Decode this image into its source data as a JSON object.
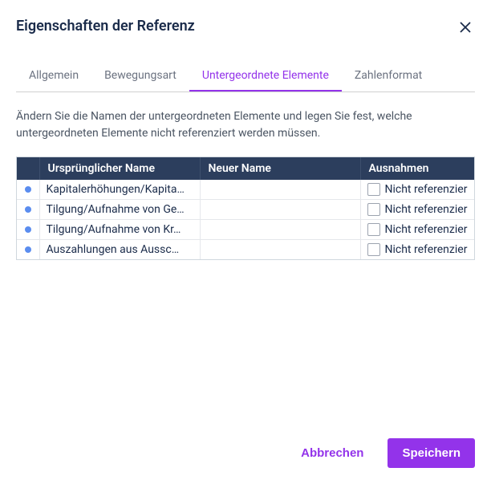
{
  "dialog": {
    "title": "Eigenschaften der Referenz"
  },
  "tabs": [
    {
      "label": "Allgemein",
      "active": false
    },
    {
      "label": "Bewegungsart",
      "active": false
    },
    {
      "label": "Untergeordnete Elemente",
      "active": true
    },
    {
      "label": "Zahlenformat",
      "active": false
    }
  ],
  "description": "Ändern Sie die Namen der untergeordneten Elemente und legen Sie fest, welche untergeordneten Elemente nicht referenziert werden müssen.",
  "table": {
    "headers": {
      "original_name": "Ursprünglicher Name",
      "new_name": "Neuer Name",
      "exceptions": "Ausnahmen"
    },
    "rows": [
      {
        "original_name": "Kapitalerhöhungen/Kapita…",
        "new_name": "",
        "exception_label": "Nicht referenzier",
        "exception_checked": false
      },
      {
        "original_name": "Tilgung/Aufnahme von Ge…",
        "new_name": "",
        "exception_label": "Nicht referenzier",
        "exception_checked": false
      },
      {
        "original_name": "Tilgung/Aufnahme von Kr…",
        "new_name": "",
        "exception_label": "Nicht referenzier",
        "exception_checked": false
      },
      {
        "original_name": "Auszahlungen aus Aussc…",
        "new_name": "",
        "exception_label": "Nicht referenzier",
        "exception_checked": false
      }
    ]
  },
  "footer": {
    "cancel_label": "Abbrechen",
    "save_label": "Speichern"
  }
}
